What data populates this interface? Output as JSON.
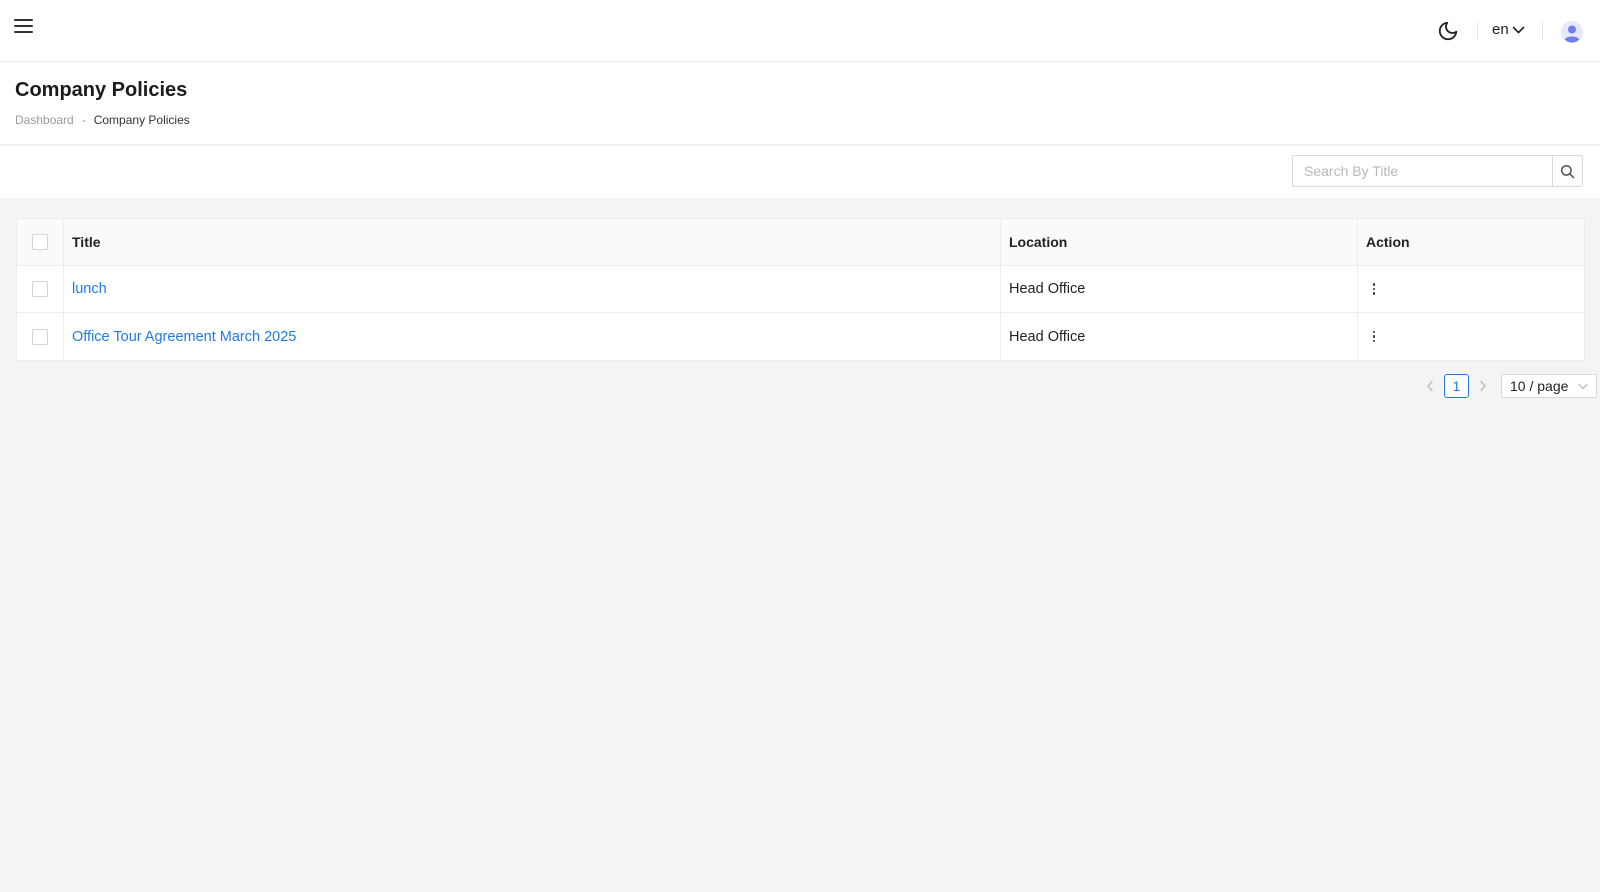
{
  "topbar": {
    "menu_icon": "hamburger-icon",
    "theme_icon": "moon-icon",
    "language": "en",
    "language_icon": "chevron-down-icon",
    "avatar_icon": "user-avatar-icon"
  },
  "page": {
    "title": "Company Policies",
    "breadcrumb": {
      "home": "Dashboard",
      "separator": "-",
      "current": "Company Policies"
    }
  },
  "search": {
    "placeholder": "Search By Title",
    "icon": "search-icon"
  },
  "table": {
    "columns": {
      "title": "Title",
      "location": "Location",
      "action": "Action"
    },
    "rows": [
      {
        "title": "lunch",
        "location": "Head Office",
        "action_icon": "more-vertical-icon"
      },
      {
        "title": "Office Tour Agreement March 2025",
        "location": "Head Office",
        "action_icon": "more-vertical-icon"
      }
    ]
  },
  "pagination": {
    "current_page": "1",
    "page_size": "10 / page"
  },
  "colors": {
    "accent": "#1e7be6",
    "background": "#f4f4f4",
    "surface": "#ffffff"
  }
}
